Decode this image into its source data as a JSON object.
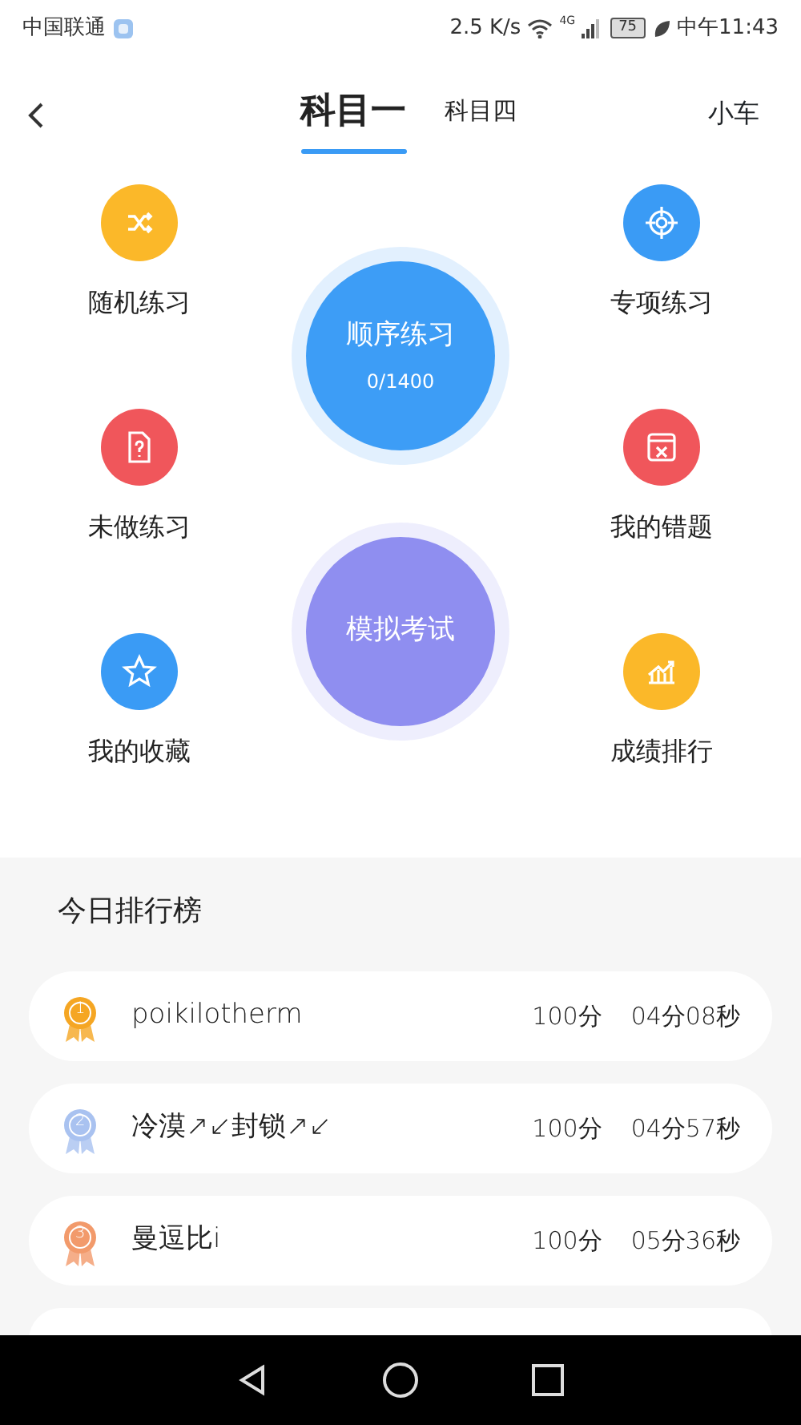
{
  "status_bar": {
    "carrier": "中国联通",
    "speed": "2.5 K/s",
    "network": "4G",
    "battery": "75",
    "time": "中午11:43"
  },
  "header": {
    "tabs": [
      {
        "label": "科目一",
        "selected": true
      },
      {
        "label": "科目四",
        "selected": false
      }
    ],
    "vehicle": "小车"
  },
  "practice_items": [
    {
      "label": "随机练习",
      "color": "#fbb829"
    },
    {
      "label": "专项练习",
      "color": "#3a9bf5"
    },
    {
      "label": "未做练习",
      "color": "#f0565b"
    },
    {
      "label": "我的错题",
      "color": "#f0565b"
    },
    {
      "label": "我的收藏",
      "color": "#3a9bf5"
    },
    {
      "label": "成绩排行",
      "color": "#fbb829"
    }
  ],
  "main_buttons": [
    {
      "label": "顺序练习",
      "progress": "0/1400",
      "color": "#3d9df6"
    },
    {
      "label": "模拟考试",
      "color": "#8f8ef0"
    }
  ],
  "leaderboard": {
    "title": "今日排行榜",
    "rows": [
      {
        "rank": "1",
        "color": "#f5a623",
        "name": "poikilotherm",
        "score": "100分",
        "time": "04分08秒"
      },
      {
        "rank": "2",
        "color": "#a9c2f0",
        "name": "冷漠↗↙封锁↗↙",
        "score": "100分",
        "time": "04分57秒"
      },
      {
        "rank": "3",
        "color": "#f29a6b",
        "name": "曼逗比i",
        "score": "100分",
        "time": "05分36秒"
      }
    ]
  }
}
